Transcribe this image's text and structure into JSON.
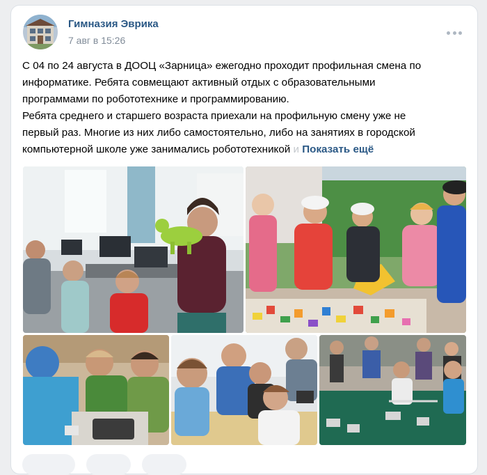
{
  "post": {
    "author": "Гимназия Эврика",
    "date": "7 авг в 15:26",
    "text_lines": [
      "С 04 по 24 августа в ДООЦ «Зарница» ежегодно проходит профильная смена по",
      "информатике. Ребята совмещают активный отдых с образовательными",
      "программами по робототехнике и программированию.",
      "Ребята среднего и старшего возраста приехали на профильную смену уже не",
      "первый раз. Многие из них либо самостоятельно, либо на занятиях в городской",
      "компьютерной школе уже занимались робототехникой"
    ],
    "ellipsis_char": "и",
    "show_more_label": "Показать ещё"
  },
  "icons": {
    "more": "more-dots-icon"
  },
  "colors": {
    "link": "#2a5885",
    "meta": "#818c99",
    "background": "#edeef0"
  }
}
